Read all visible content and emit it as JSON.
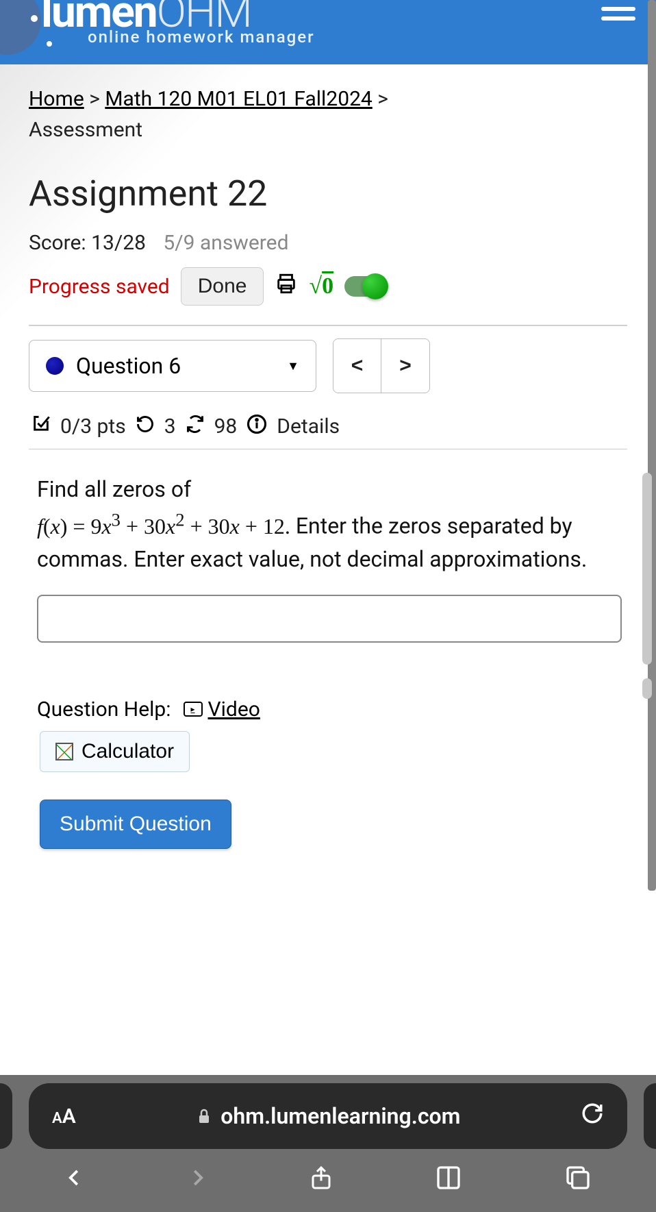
{
  "header": {
    "brand_part1": "lumen",
    "brand_part2": "OHM",
    "tagline": "online homework manager"
  },
  "breadcrumb": {
    "home": "Home",
    "course": "Math 120 M01 EL01 Fall2024",
    "page": "Assessment"
  },
  "title": "Assignment 22",
  "score": {
    "label": "Score:",
    "value": "13/28",
    "answered": "5/9 answered"
  },
  "progress": {
    "saved": "Progress saved",
    "done": "Done"
  },
  "question_nav": {
    "current": "Question 6"
  },
  "meta": {
    "pts": "0/3 pts",
    "attempts": "3",
    "regen": "98",
    "details": "Details"
  },
  "question": {
    "lead": "Find all zeros of",
    "func": "f(x) = 9x",
    "more": " + 30x",
    "more2": " + 30x + 12.",
    "tail": " Enter the zeros separated by commas. Enter exact value, not decimal approximations."
  },
  "help": {
    "label": "Question Help:",
    "video": "Video",
    "calc": "Calculator"
  },
  "submit": "Submit Question",
  "url": "ohm.lumenlearning.com",
  "aa": "A"
}
